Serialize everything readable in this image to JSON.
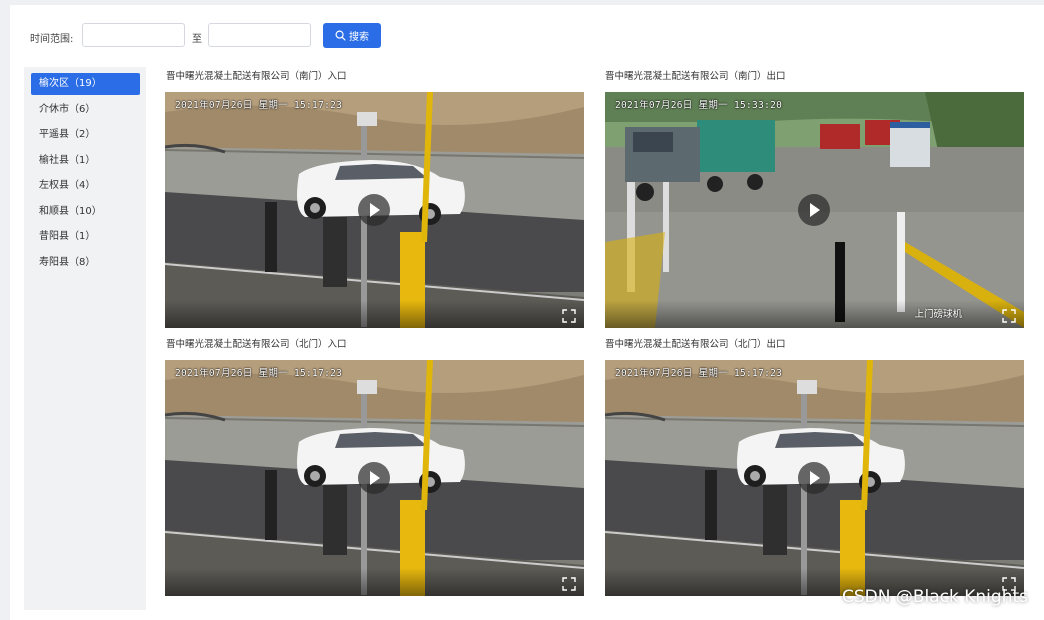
{
  "search": {
    "time_range_label": "时间范围:",
    "to_label": "至",
    "start_value": "",
    "end_value": "",
    "button_label": "搜索",
    "button_icon": "search-icon"
  },
  "sidebar": {
    "items": [
      {
        "label": "榆次区（19）",
        "active": true
      },
      {
        "label": "介休市（6）",
        "active": false
      },
      {
        "label": "平遥县（2）",
        "active": false
      },
      {
        "label": "榆社县（1）",
        "active": false
      },
      {
        "label": "左权县（4）",
        "active": false
      },
      {
        "label": "和顺县（10）",
        "active": false
      },
      {
        "label": "昔阳县（1）",
        "active": false
      },
      {
        "label": "寿阳县（8）",
        "active": false
      }
    ]
  },
  "cameras": [
    {
      "title": "晋中曙光混凝土配送有限公司（南门）入口",
      "osd": "2021年07月26日  星期一  15:17:23",
      "caption": "",
      "scene": "barrier"
    },
    {
      "title": "晋中曙光混凝土配送有限公司（南门）出口",
      "osd": "2021年07月26日  星期一  15:33:20",
      "caption": "上门磅球机",
      "scene": "trucks"
    },
    {
      "title": "晋中曙光混凝土配送有限公司（北门）入口",
      "osd": "2021年07月26日  星期一  15:17:23",
      "caption": "",
      "scene": "barrier"
    },
    {
      "title": "晋中曙光混凝土配送有限公司（北门）出口",
      "osd": "2021年07月26日  星期一  15:17:23",
      "caption": "",
      "scene": "barrier"
    }
  ],
  "watermark": "CSDN @Black Knights",
  "colors": {
    "accent": "#2b6de6",
    "sidebar_bg": "#f1f2f4",
    "page_bg": "#eef0f4"
  }
}
